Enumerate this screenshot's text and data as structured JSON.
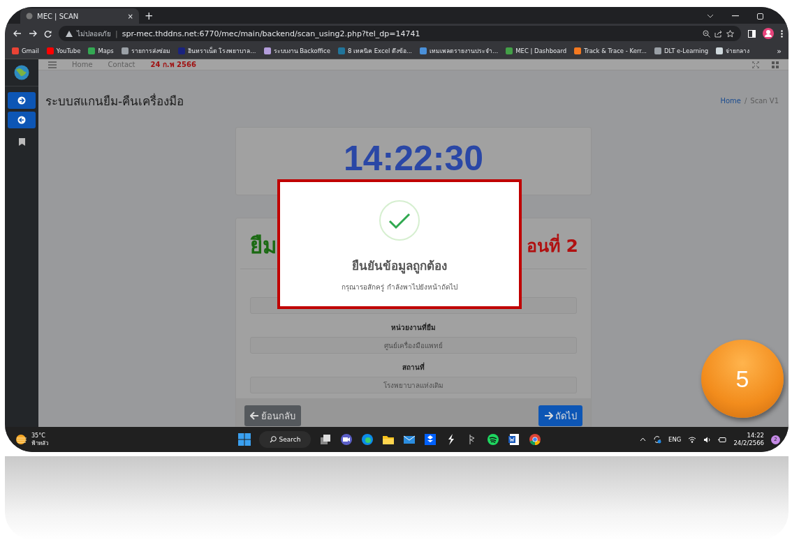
{
  "browser": {
    "tabs": [
      {
        "title": "MEC | SCAN",
        "selected": true,
        "close": "×"
      }
    ],
    "new_tab": "+",
    "security": "ไม่ปลอดภัย",
    "separator": "|",
    "url": "spr-mec.thddns.net:6770/mec/main/backend/scan_using2.php?tel_dp=14741",
    "bookmarks": [
      {
        "label": "Gmail",
        "color": "#ea4335"
      },
      {
        "label": "YouTube",
        "color": "#ff0000"
      },
      {
        "label": "Maps",
        "color": "#34a853"
      },
      {
        "label": "รายการส่งซ่อม",
        "color": "#9aa0a6"
      },
      {
        "label": "อินทราเน็ต โรงพยาบาล...",
        "color": "#1a237e"
      },
      {
        "label": "ระบบงาน Backoffice",
        "color": "#b39ddb"
      },
      {
        "label": "8 เทคนิค Excel ดึงข้อ...",
        "color": "#21759b"
      },
      {
        "label": "เทมเพลตรายงานประจำ...",
        "color": "#4a90d9"
      },
      {
        "label": "MEC | Dashboard",
        "color": "#43a047"
      },
      {
        "label": "Track & Trace - Kerr...",
        "color": "#f47920"
      },
      {
        "label": "DLT e-Learning",
        "color": "#9aa0a6"
      },
      {
        "label": "จ่ายกลาง",
        "color": "#cfd8dc"
      }
    ],
    "more": "»"
  },
  "nav": {
    "links": [
      "Home",
      "Contact"
    ],
    "date": "24 ก.พ 2566"
  },
  "page": {
    "title": "ระบบสแกนยืม-คืนเครื่องมือ",
    "breadcrumb": [
      "Home",
      "Scan V1"
    ],
    "breadcrumb_separator": "/"
  },
  "clock": "14:22:30",
  "form": {
    "heading_left": "ยืม",
    "heading_right": "อนที่ 2",
    "fields": [
      {
        "label": "หน่วยงานที่ยืม",
        "value": "ศูนย์เครื่องมือแพทย์"
      },
      {
        "label": "สถานที่",
        "value": "โรงพยาบาลแห่งเดิม"
      }
    ],
    "back": "ย้อนกลับ",
    "next": "ถัดไป"
  },
  "dialog": {
    "title": "ยืนยันข้อมูลถูกต้อง",
    "message": "กรุณารอสักครู่ กำลังพาไปยังหน้าถัดไป"
  },
  "step_badge": "5",
  "taskbar": {
    "temperature": "35°C",
    "weather": "ฟ้าหลัว",
    "search": "Search",
    "language": "ENG",
    "time": "14:22",
    "date": "24/2/2566",
    "notifications": "2"
  }
}
